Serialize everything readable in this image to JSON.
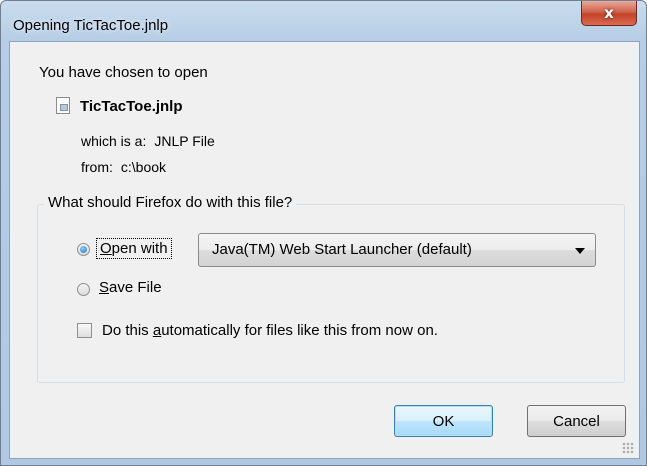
{
  "window": {
    "title": "Opening TicTacToe.jnlp",
    "close_label": "x"
  },
  "file": {
    "chosen_label": "You have chosen to open",
    "name": "TicTacToe.jnlp",
    "icon": "file-icon",
    "which_label": "which is a:",
    "which_value": "JNLP File",
    "from_label": "from:",
    "from_value": "c:\\book"
  },
  "action_group": {
    "title": "What should Firefox do with this file?",
    "open_with": {
      "label_mnemonic": "O",
      "label_rest": "pen with",
      "selected": true,
      "application": "Java(TM) Web Start Launcher (default)"
    },
    "save_file": {
      "label_mnemonic": "S",
      "label_rest": "ave File",
      "selected": false
    },
    "auto": {
      "label_before": "Do this ",
      "label_mnemonic": "a",
      "label_after": "utomatically for files like this from now on.",
      "checked": false
    }
  },
  "buttons": {
    "ok": "OK",
    "cancel": "Cancel"
  },
  "colors": {
    "frame": "#b6cde5",
    "client": "#f0f0f0",
    "close_button": "#c4442a",
    "default_button_border": "#3c7fb1"
  }
}
